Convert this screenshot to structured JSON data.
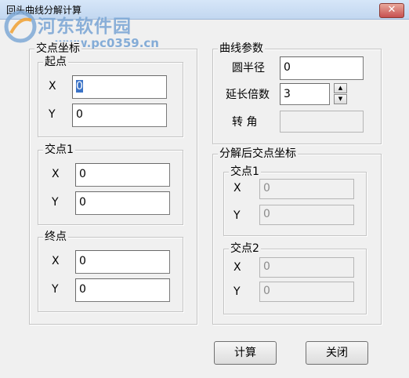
{
  "window": {
    "title": "回头曲线分解计算",
    "close_glyph": "✕"
  },
  "watermark": {
    "line1": "河东软件园",
    "line2": "www.pc0359.cn"
  },
  "intersection_coords": {
    "title": "交点坐标",
    "start": {
      "title": "起点",
      "x_label": "X",
      "x_value": "0",
      "y_label": "Y",
      "y_value": "0"
    },
    "jd1": {
      "title": "交点1",
      "x_label": "X",
      "x_value": "0",
      "y_label": "Y",
      "y_value": "0"
    },
    "end": {
      "title": "终点",
      "x_label": "X",
      "x_value": "0",
      "y_label": "Y",
      "y_value": "0"
    }
  },
  "curve_params": {
    "title": "曲线参数",
    "radius_label": "圆半径",
    "radius_value": "0",
    "ext_label": "延长倍数",
    "ext_value": "3",
    "angle_label": "转 角",
    "angle_value": ""
  },
  "decomposed": {
    "title": "分解后交点坐标",
    "jd1": {
      "title": "交点1",
      "x_label": "X",
      "x_value": "0",
      "y_label": "Y",
      "y_value": "0"
    },
    "jd2": {
      "title": "交点2",
      "x_label": "X",
      "x_value": "0",
      "y_label": "Y",
      "y_value": "0"
    }
  },
  "buttons": {
    "calculate": "计算",
    "close": "关闭"
  }
}
